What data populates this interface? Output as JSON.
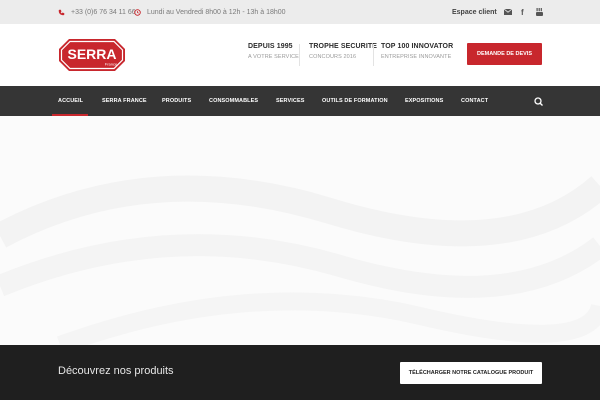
{
  "topbar": {
    "phone": "+33 (0)6 76 34 11 66",
    "hours": "Lundi au Vendredi 8h00 à 12h - 13h à 18h00",
    "client_link": "Espace client",
    "social": [
      {
        "icon": "envelope-icon"
      },
      {
        "icon": "facebook-icon",
        "glyph": "f"
      },
      {
        "icon": "youtube-icon"
      }
    ]
  },
  "header": {
    "logo": {
      "name": "SERRA",
      "sub": "France"
    },
    "highlights": [
      {
        "title": "DEPUIS 1995",
        "subtitle": "A VOTRE SERVICE"
      },
      {
        "title": "TROPHE SECURITE",
        "subtitle": "CONCOURS 2016"
      },
      {
        "title": "TOP 100 INNOVATOR",
        "subtitle": "ENTREPRISE INNOVANTE"
      }
    ],
    "cta_label": "DEMANDE DE DEVIS"
  },
  "nav": {
    "items": [
      {
        "label": "ACCUEIL"
      },
      {
        "label": "SERRA FRANCE"
      },
      {
        "label": "PRODUITS"
      },
      {
        "label": "CONSOMMABLES"
      },
      {
        "label": "SERVICES"
      },
      {
        "label": "OUTILS DE FORMATION"
      },
      {
        "label": "EXPOSITIONS"
      },
      {
        "label": "CONTACT"
      }
    ],
    "active": "ACCUEIL"
  },
  "banner": {
    "text": "Découvrez nos produits",
    "button_label": "TÉLÉCHARGER NOTRE CATALOGUE PRODUIT"
  },
  "colors": {
    "brand": "#c8272d",
    "nav_bg": "#353535",
    "band_bg": "#1f1f1f",
    "topbar_bg": "#ececec"
  }
}
